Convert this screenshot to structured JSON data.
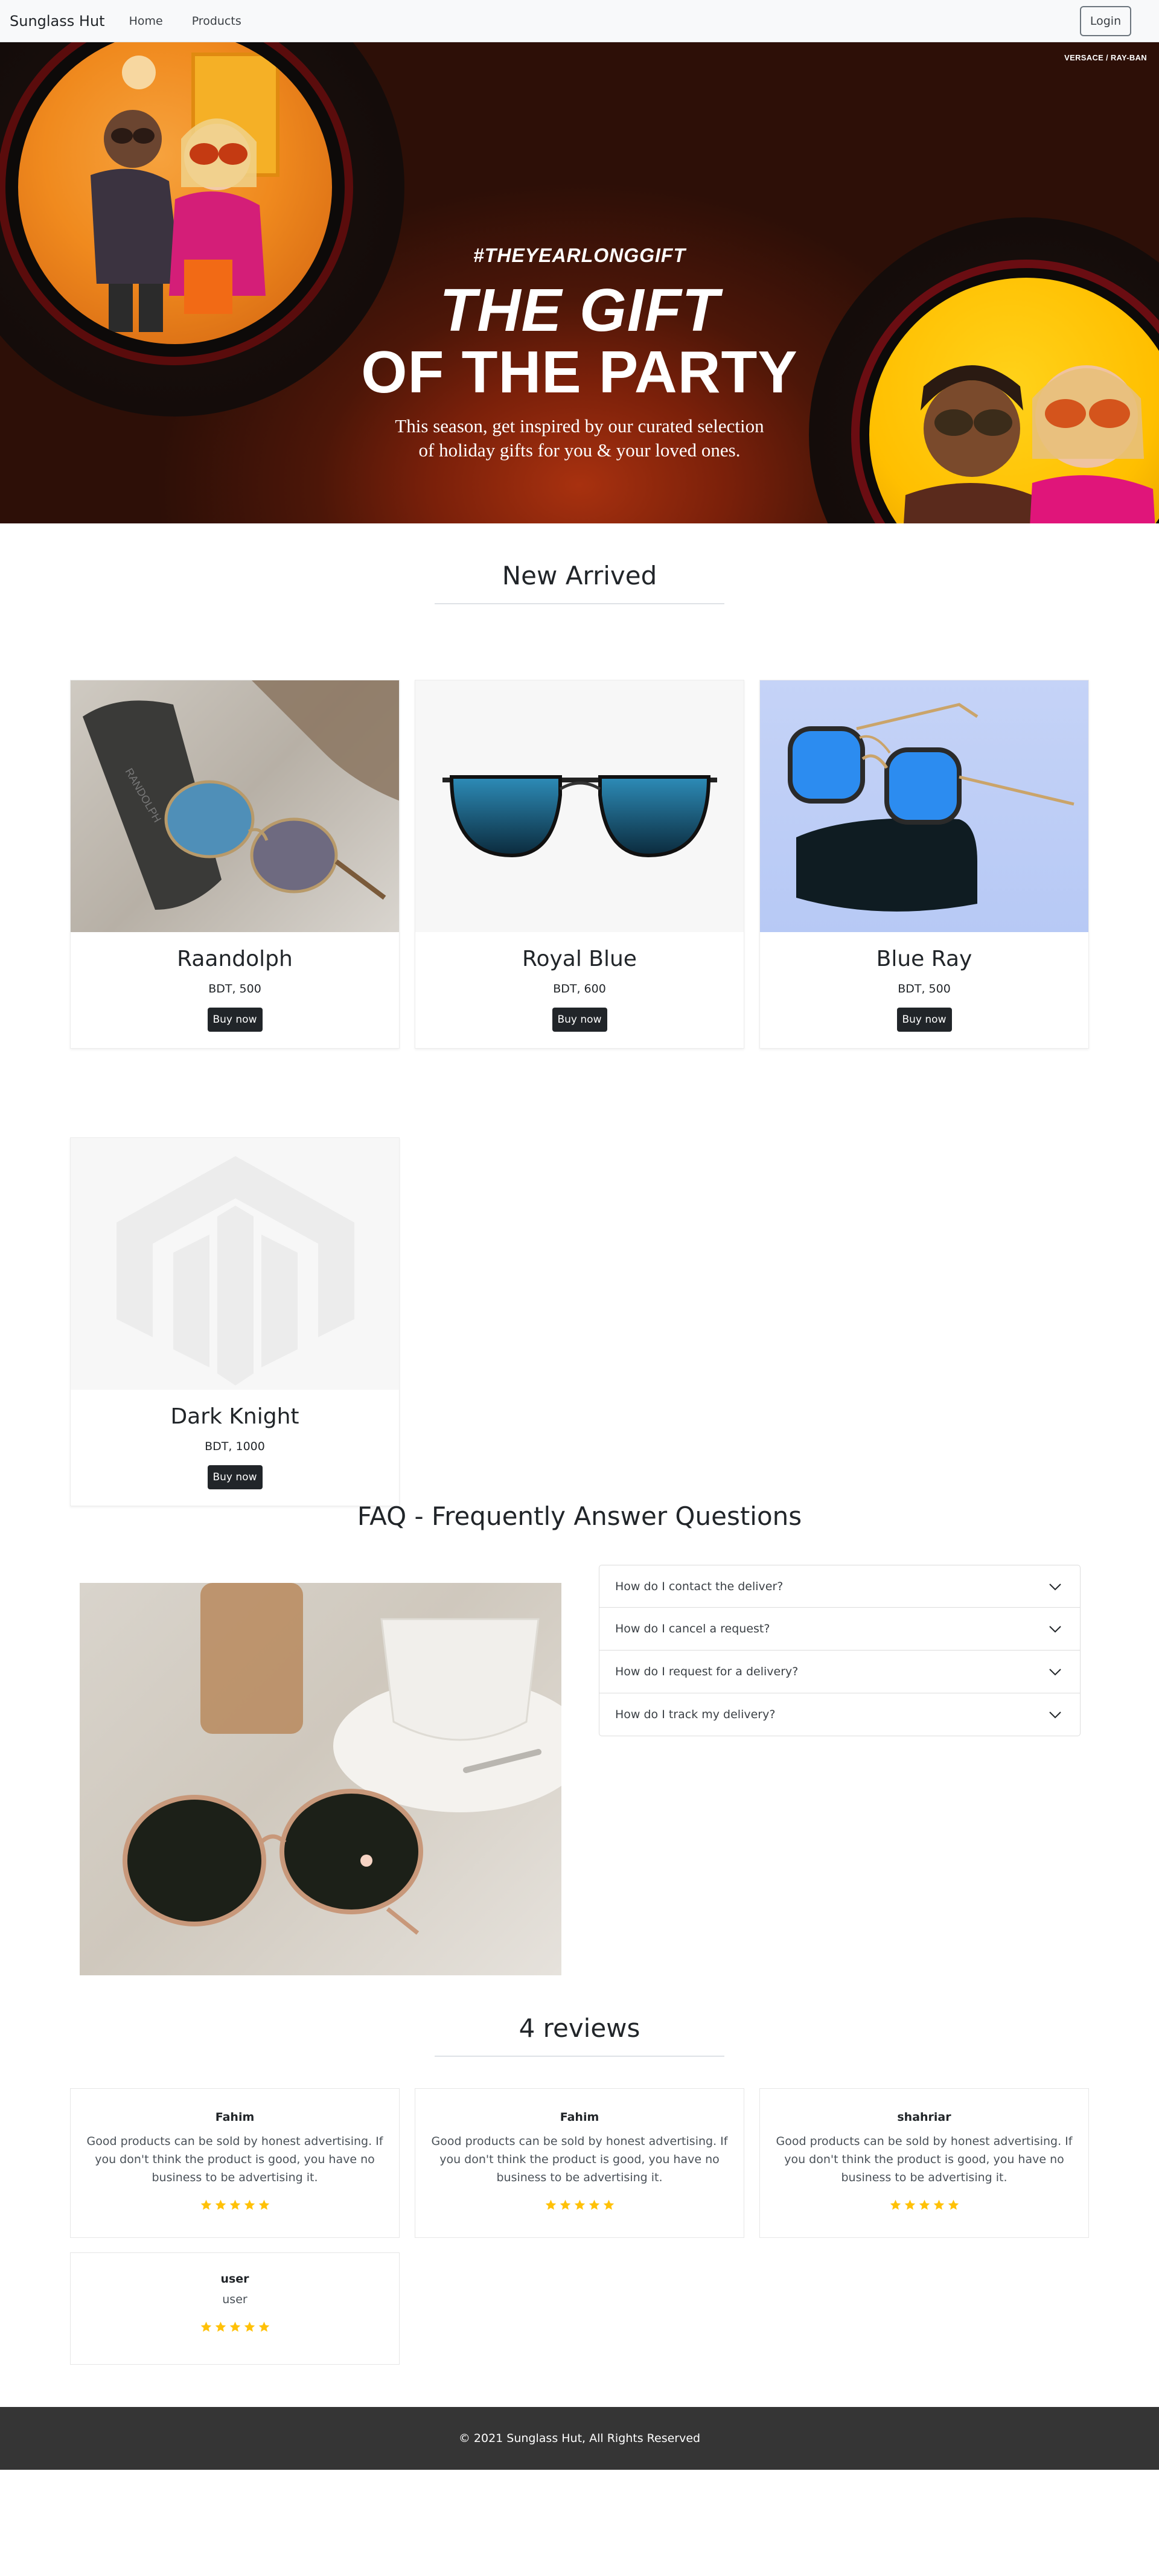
{
  "navbar": {
    "brand": "Sunglass Hut",
    "links": [
      "Home",
      "Products"
    ],
    "login_label": "Login"
  },
  "hero": {
    "brand_tag": "VERSACE / RAY-BAN",
    "hashtag": "#THEYEARLONGGIFT",
    "title_line1": "THE GIFT",
    "title_line2": "OF THE PARTY",
    "subtitle_line1": "This season, get inspired by our curated selection",
    "subtitle_line2": "of holiday gifts for you & your loved ones."
  },
  "products": {
    "section_title": "New Arrived",
    "items": [
      {
        "name": "Raandolph",
        "price": "BDT, 500",
        "button": "Buy now",
        "case_text": "RANDOLPH"
      },
      {
        "name": "Royal Blue",
        "price": "BDT, 600",
        "button": "Buy now"
      },
      {
        "name": "Blue Ray",
        "price": "BDT, 500",
        "button": "Buy now"
      },
      {
        "name": "Dark Knight",
        "price": "BDT, 1000",
        "button": "Buy now"
      }
    ]
  },
  "faq": {
    "section_title": "FAQ - Frequently Answer Questions",
    "items": [
      "How do I contact the deliver?",
      "How do I cancel a request?",
      "How do I request for a delivery?",
      "How do I track my delivery?"
    ]
  },
  "reviews": {
    "section_title": "4 reviews",
    "items": [
      {
        "name": "Fahim",
        "text": "Good products can be sold by honest advertising. If you don't think the product is good, you have no business to be advertising it.",
        "rating": 5
      },
      {
        "name": "Fahim",
        "text": "Good products can be sold by honest advertising. If you don't think the product is good, you have no business to be advertising it.",
        "rating": 5
      },
      {
        "name": "shahriar",
        "text": "Good products can be sold by honest advertising. If you don't think the product is good, you have no business to be advertising it.",
        "rating": 5
      },
      {
        "name": "user",
        "text": "user",
        "rating": 5
      }
    ],
    "star_color": "#ffc107"
  },
  "footer": {
    "text": "© 2021 Sunglass Hut, All Rights Reserved"
  }
}
